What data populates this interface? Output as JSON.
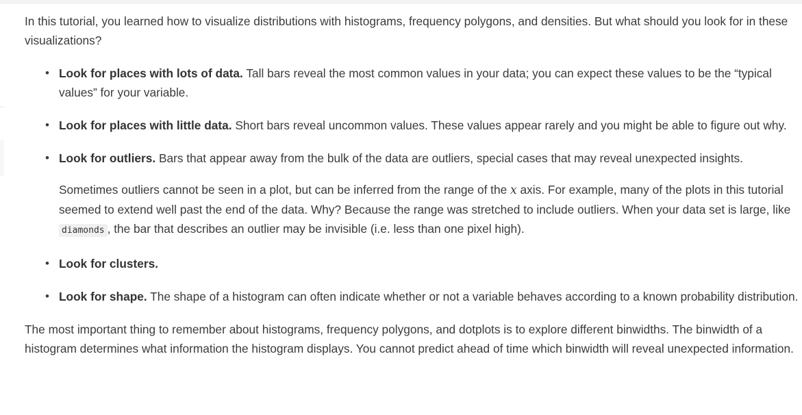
{
  "intro": "In this tutorial, you learned how to visualize distributions with histograms, frequency polygons, and densities. But what should you look for in these visualizations?",
  "tips": [
    {
      "title": "Look for places with lots of data.",
      "text": " Tall bars reveal the most common values in your data; you can expect these values to be the “typical values” for your variable."
    },
    {
      "title": "Look for places with little data.",
      "text": " Short bars reveal uncommon values. These values appear rarely and you might be able to figure out why."
    },
    {
      "title": "Look for outliers.",
      "text": " Bars that appear away from the bulk of the data are outliers, special cases that may reveal unexpected insights.",
      "extra_pre": "Sometimes outliers cannot be seen in a plot, but can be inferred from the range of the ",
      "extra_math": "x",
      "extra_mid": " axis. For example, many of the plots in this tutorial seemed to extend well past the end of the data. Why? Because the range was stretched to include outliers. When your data set is large, like ",
      "extra_code": "diamonds",
      "extra_post": ", the bar that describes an outlier may be invisible (i.e. less than one pixel high)."
    },
    {
      "title": "Look for clusters.",
      "text": ""
    },
    {
      "title": "Look for shape.",
      "text": " The shape of a histogram can often indicate whether or not a variable behaves according to a known probability distribution."
    }
  ],
  "bullet": "•",
  "outro": "The most important thing to remember about histograms, frequency polygons, and dotplots is to explore different binwidths. The binwidth of a histogram determines what information the histogram displays. You cannot predict ahead of time which binwidth will reveal unexpected information."
}
